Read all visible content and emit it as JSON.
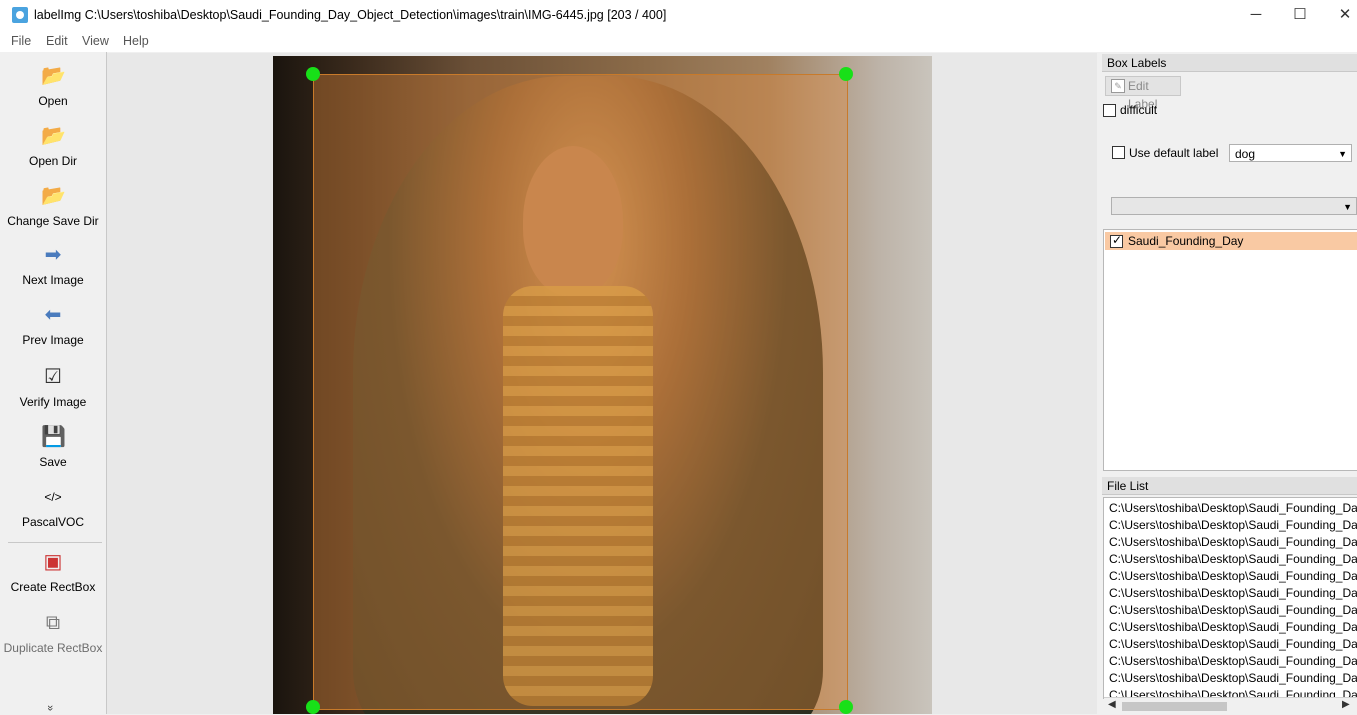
{
  "window": {
    "title": "labelImg C:\\Users\\toshiba\\Desktop\\Saudi_Founding_Day_Object_Detection\\images\\train\\IMG-6445.jpg [203 / 400]",
    "minimize": "─",
    "maximize": "☐",
    "close": "✕"
  },
  "menu": [
    "File",
    "Edit",
    "View",
    "Help"
  ],
  "toolbar": {
    "open": "Open",
    "open_dir": "Open Dir",
    "change_save_dir": "Change Save Dir",
    "next_image": "Next Image",
    "prev_image": "Prev Image",
    "verify_image": "Verify Image",
    "save": "Save",
    "format": "PascalVOC",
    "create_rectbox": "Create RectBox",
    "duplicate_rectbox": "Duplicate RectBox",
    "more": "»"
  },
  "box_labels": {
    "title": "Box Labels",
    "edit_label": "Edit Label",
    "difficult": "difficult",
    "use_default_label": "Use default label",
    "default_label_value": "dog",
    "labels": [
      {
        "name": "Saudi_Founding_Day",
        "checked": true
      }
    ]
  },
  "file_list": {
    "title": "File List",
    "files": [
      "C:\\Users\\toshiba\\Desktop\\Saudi_Founding_Da",
      "C:\\Users\\toshiba\\Desktop\\Saudi_Founding_Da",
      "C:\\Users\\toshiba\\Desktop\\Saudi_Founding_Da",
      "C:\\Users\\toshiba\\Desktop\\Saudi_Founding_Da",
      "C:\\Users\\toshiba\\Desktop\\Saudi_Founding_Da",
      "C:\\Users\\toshiba\\Desktop\\Saudi_Founding_Da",
      "C:\\Users\\toshiba\\Desktop\\Saudi_Founding_Da",
      "C:\\Users\\toshiba\\Desktop\\Saudi_Founding_Da",
      "C:\\Users\\toshiba\\Desktop\\Saudi_Founding_Da",
      "C:\\Users\\toshiba\\Desktop\\Saudi_Founding_Da",
      "C:\\Users\\toshiba\\Desktop\\Saudi_Founding_Da",
      "C:\\Users\\toshiba\\Desktop\\Saudi_Founding_Da"
    ]
  },
  "colors": {
    "selection": "#f9c9a3",
    "bbox_fill": "#e68c3c",
    "handle": "#18e018"
  }
}
